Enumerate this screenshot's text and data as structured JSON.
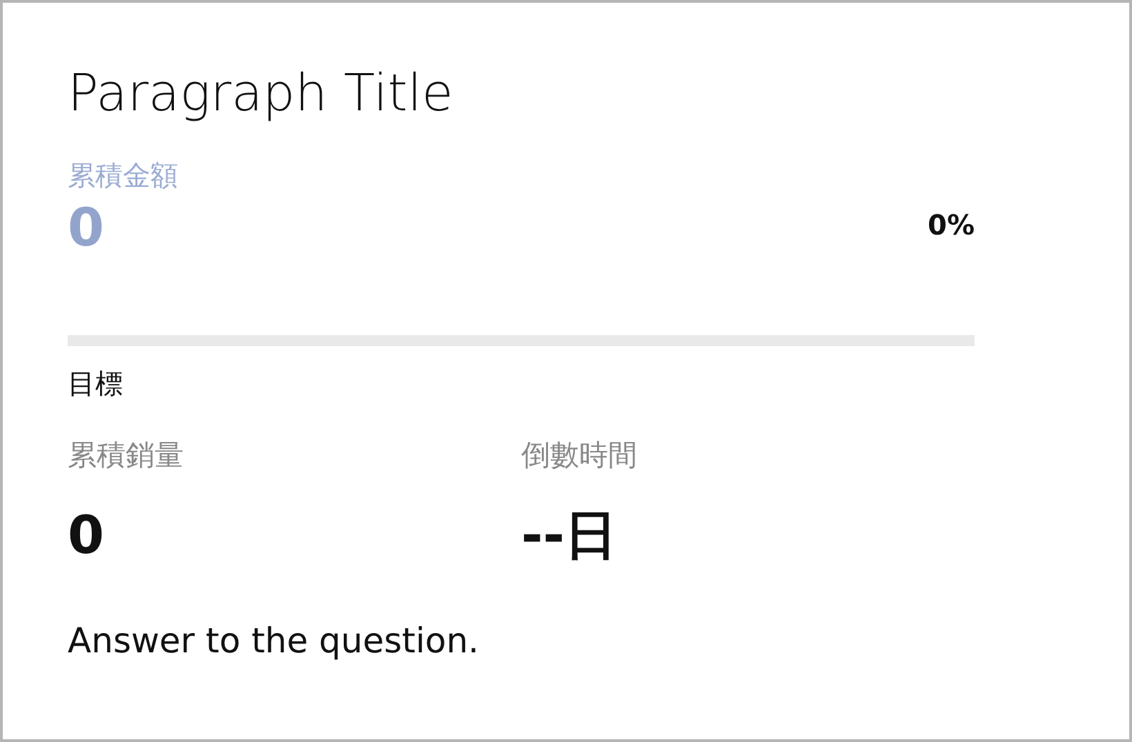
{
  "title": "Paragraph Title",
  "amount": {
    "label": "累積金額",
    "value": "0",
    "percent": "0%",
    "level": 0
  },
  "goal_label": "目標",
  "stats": [
    {
      "label": "累積銷量",
      "value": "0"
    },
    {
      "label": "倒數時間",
      "value": "--日"
    }
  ],
  "answer": "Answer to the question."
}
